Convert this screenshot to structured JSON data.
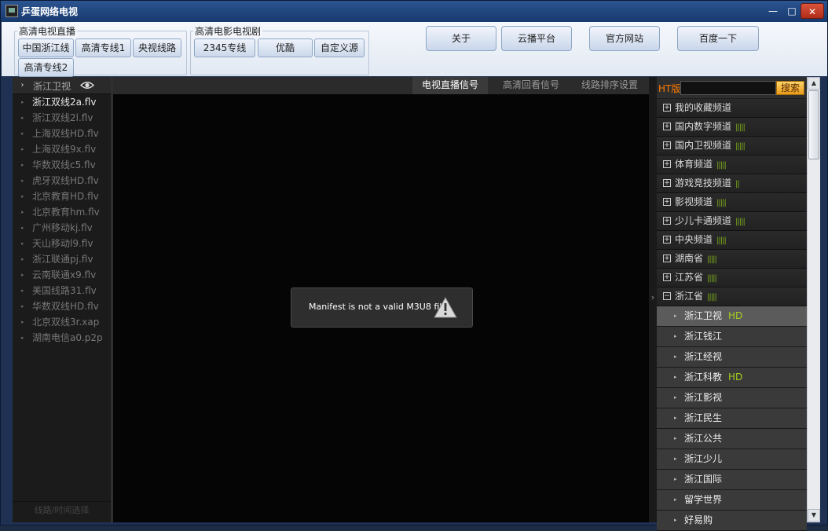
{
  "window": {
    "title": "乒蛋网络电视",
    "min": "—",
    "max": "□",
    "close": "✕"
  },
  "toolbar": {
    "tv_group": {
      "title": "高清电视直播",
      "buttons": [
        "中国浙江线",
        "高清专线1",
        "央视线路",
        "高清专线2"
      ]
    },
    "movie_group": {
      "title": "高清电影电视剧",
      "buttons": [
        "2345专线",
        "优酷",
        "自定义源"
      ]
    },
    "big_buttons": [
      "关于",
      "云播平台",
      "官方网站",
      "百度一下"
    ]
  },
  "left": {
    "expand_icon": "›",
    "channel": "浙江卫视",
    "sources": [
      "浙江双线2a.flv",
      "浙江双线2l.flv",
      "上海双线HD.flv",
      "上海双线9x.flv",
      "华数双线c5.flv",
      "虎牙双线HD.flv",
      "北京教育HD.flv",
      "北京教育hm.flv",
      "广州移动kj.flv",
      "天山移动l9.flv",
      "浙江联通pj.flv",
      "云南联通x9.flv",
      "美国线路31.flv",
      "华数双线HD.flv",
      "北京双线3r.xap",
      "湖南电信a0.p2p"
    ],
    "active_index": 0,
    "footer": "线路/时间选择"
  },
  "video": {
    "tabs": [
      "电视直播信号",
      "高清回看信号",
      "线路排序设置"
    ],
    "active_tab": 0,
    "message": "Manifest is not a valid M3U8 file",
    "collapse_arrow": "›"
  },
  "right": {
    "ht_label": "HT版",
    "search_placeholder": "",
    "search_button": "搜索",
    "categories": [
      {
        "name": "我的收藏频道",
        "icon": "+",
        "signal": ""
      },
      {
        "name": "国内数字频道",
        "icon": "+",
        "signal": "|||||"
      },
      {
        "name": "国内卫视频道",
        "icon": "+",
        "signal": "|||||"
      },
      {
        "name": "体育频道",
        "icon": "+",
        "signal": "|||||"
      },
      {
        "name": "游戏竞技频道",
        "icon": "+",
        "signal": "||"
      },
      {
        "name": "影视频道",
        "icon": "+",
        "signal": "|||||"
      },
      {
        "name": "少儿卡通频道",
        "icon": "+",
        "signal": "|||||"
      },
      {
        "name": "中央频道",
        "icon": "+",
        "signal": "|||||"
      },
      {
        "name": "湖南省",
        "icon": "+",
        "signal": "|||||"
      },
      {
        "name": "江苏省",
        "icon": "+",
        "signal": "|||||"
      },
      {
        "name": "浙江省",
        "icon": "−",
        "signal": "|||||"
      }
    ],
    "channels": [
      {
        "name": "浙江卫视",
        "badge": "HD"
      },
      {
        "name": "浙江钱江",
        "badge": ""
      },
      {
        "name": "浙江经视",
        "badge": ""
      },
      {
        "name": "浙江科教",
        "badge": "HD"
      },
      {
        "name": "浙江影视",
        "badge": ""
      },
      {
        "name": "浙江民生",
        "badge": ""
      },
      {
        "name": "浙江公共",
        "badge": ""
      },
      {
        "name": "浙江少儿",
        "badge": ""
      },
      {
        "name": "浙江国际",
        "badge": ""
      },
      {
        "name": "留学世界",
        "badge": ""
      },
      {
        "name": "好易购",
        "badge": ""
      }
    ],
    "selected_channel": 0
  },
  "colors": {
    "accent_orange": "#ff7a00",
    "hd_green": "#a6d11e",
    "signal_green": "#7ba81c"
  }
}
